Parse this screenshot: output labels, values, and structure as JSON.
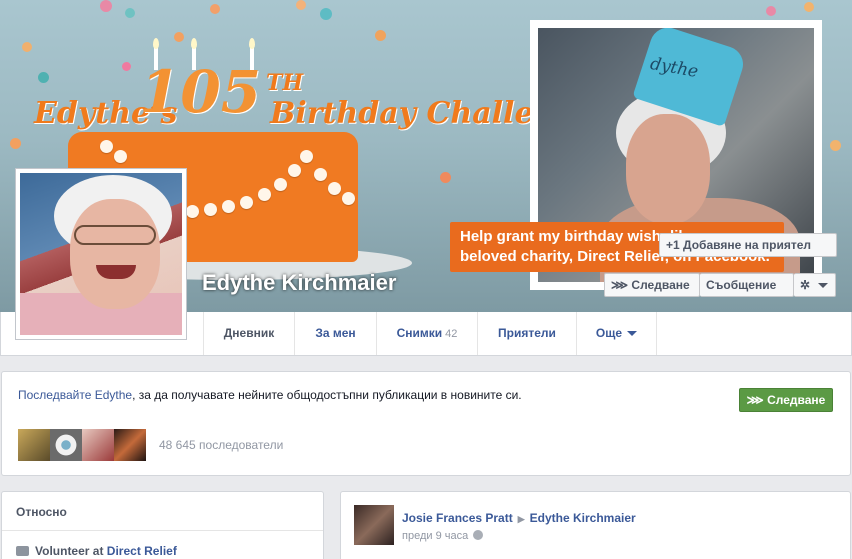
{
  "cover": {
    "banner_part1": "Edythe’s",
    "banner_number": "105",
    "banner_th": "TH",
    "banner_part2": "Birthday Challenge",
    "hat_text": "dythe",
    "callout_text": "Help grant my birthday wish: like my beloved charity, Direct Relief, on Facebook."
  },
  "profile": {
    "name": "Edythe Kirchmaier"
  },
  "actions": {
    "add_friend": "Добавяне на приятел",
    "follow": "Следване",
    "message": "Съобщение"
  },
  "icons": {
    "add_friend": "+1",
    "follow": "rss-icon",
    "gear": "gear-icon",
    "dropdown": "chevron-down-icon"
  },
  "nav": {
    "tabs": [
      {
        "label": "Дневник"
      },
      {
        "label": "За мен"
      },
      {
        "label": "Снимки",
        "count": "42"
      },
      {
        "label": "Приятели"
      },
      {
        "label": "Още"
      }
    ]
  },
  "follow_box": {
    "name_link": "Последвайте Edythe",
    "text_rest": ", за да получавате нейните общодостъпни публикации в новините си.",
    "followers": "48 645 последователи",
    "button": "Следване"
  },
  "about": {
    "title": "Относно",
    "item_prefix": "Volunteer at ",
    "item_link": "Direct Relief"
  },
  "post": {
    "author": "Josie Frances Pratt",
    "target": "Edythe Kirchmaier",
    "time": "преди 9 часа"
  },
  "colors": {
    "link": "#3b5998",
    "orange": "#e96b1e",
    "green_button": "#5b9a44"
  }
}
